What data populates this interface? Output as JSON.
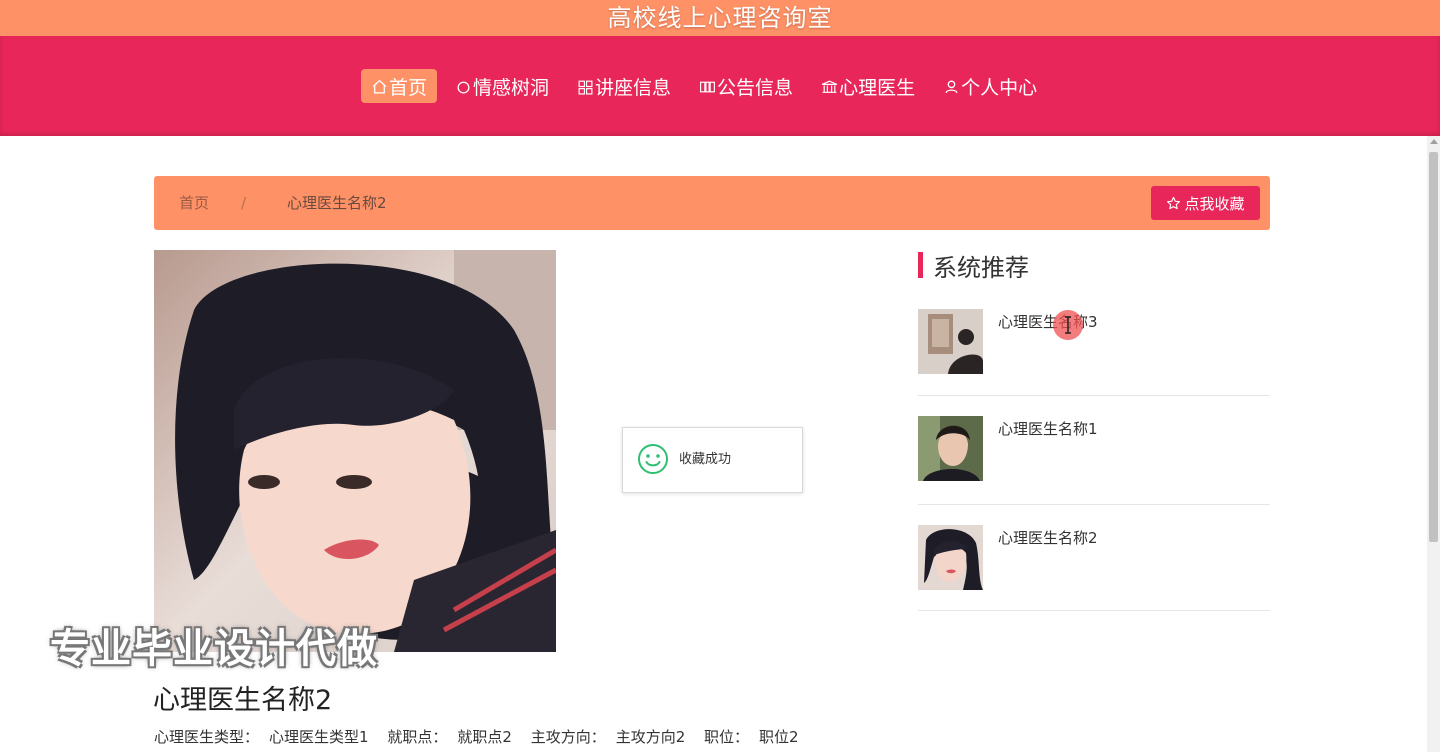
{
  "site": {
    "title": "高校线上心理咨询室"
  },
  "nav": {
    "items": [
      {
        "label": "首页",
        "icon": "home-icon",
        "active": true
      },
      {
        "label": "情感树洞",
        "icon": "circle-icon",
        "active": false
      },
      {
        "label": "讲座信息",
        "icon": "grid-icon",
        "active": false
      },
      {
        "label": "公告信息",
        "icon": "columns-icon",
        "active": false
      },
      {
        "label": "心理医生",
        "icon": "library-icon",
        "active": false
      },
      {
        "label": "个人中心",
        "icon": "user-icon",
        "active": false
      }
    ]
  },
  "breadcrumb": {
    "home": "首页",
    "separator": "/",
    "current": "心理医生名称2",
    "favorite_button": "点我收藏"
  },
  "toast": {
    "message": "收藏成功"
  },
  "recommend": {
    "title": "系统推荐",
    "items": [
      {
        "name": "心理医生名称3"
      },
      {
        "name": "心理医生名称1"
      },
      {
        "name": "心理医生名称2"
      }
    ]
  },
  "watermark": "专业毕业设计代做",
  "detail": {
    "name": "心理医生名称2",
    "fields": [
      {
        "label": "心理医生类型：",
        "value": "心理医生类型1"
      },
      {
        "label": "就职点：",
        "value": "就职点2"
      },
      {
        "label": "主攻方向：",
        "value": "主攻方向2"
      },
      {
        "label": "职位：",
        "value": "职位2"
      }
    ]
  },
  "colors": {
    "primary": "#e8265a",
    "accent": "#ff9166"
  }
}
